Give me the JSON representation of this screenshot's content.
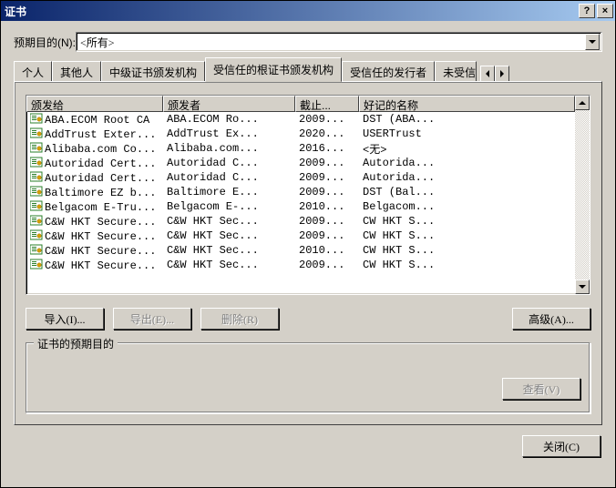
{
  "window": {
    "title": "证书"
  },
  "purpose": {
    "label": "预期目的(N):",
    "value": "<所有>"
  },
  "tabs": [
    {
      "label": "个人"
    },
    {
      "label": "其他人"
    },
    {
      "label": "中级证书颁发机构"
    },
    {
      "label": "受信任的根证书颁发机构"
    },
    {
      "label": "受信任的发行者"
    },
    {
      "label": "未受信任"
    }
  ],
  "columns": {
    "c0": "颁发给",
    "c1": "颁发者",
    "c2": "截止...",
    "c3": "好记的名称"
  },
  "rows": [
    {
      "c0": "ABA.ECOM Root CA",
      "c1": "ABA.ECOM Ro...",
      "c2": "2009...",
      "c3": "DST (ABA..."
    },
    {
      "c0": "AddTrust Exter...",
      "c1": "AddTrust Ex...",
      "c2": "2020...",
      "c3": "USERTrust"
    },
    {
      "c0": "Alibaba.com Co...",
      "c1": "Alibaba.com...",
      "c2": "2016...",
      "c3": "<无>"
    },
    {
      "c0": "Autoridad Cert...",
      "c1": "Autoridad C...",
      "c2": "2009...",
      "c3": "Autorida..."
    },
    {
      "c0": "Autoridad Cert...",
      "c1": "Autoridad C...",
      "c2": "2009...",
      "c3": "Autorida..."
    },
    {
      "c0": "Baltimore EZ b...",
      "c1": "Baltimore E...",
      "c2": "2009...",
      "c3": "DST (Bal..."
    },
    {
      "c0": "Belgacom E-Tru...",
      "c1": "Belgacom E-...",
      "c2": "2010...",
      "c3": "Belgacom..."
    },
    {
      "c0": "C&W HKT Secure...",
      "c1": "C&W HKT Sec...",
      "c2": "2009...",
      "c3": "CW HKT S..."
    },
    {
      "c0": "C&W HKT Secure...",
      "c1": "C&W HKT Sec...",
      "c2": "2009...",
      "c3": "CW HKT S..."
    },
    {
      "c0": "C&W HKT Secure...",
      "c1": "C&W HKT Sec...",
      "c2": "2010...",
      "c3": "CW HKT S..."
    },
    {
      "c0": "C&W HKT Secure...",
      "c1": "C&W HKT Sec...",
      "c2": "2009...",
      "c3": "CW HKT S..."
    }
  ],
  "buttons": {
    "import": "导入(I)...",
    "export": "导出(E)...",
    "remove": "删除(R)",
    "advanced": "高级(A)...",
    "view": "查看(V)",
    "close": "关闭(C)"
  },
  "group": {
    "title": "证书的预期目的"
  }
}
